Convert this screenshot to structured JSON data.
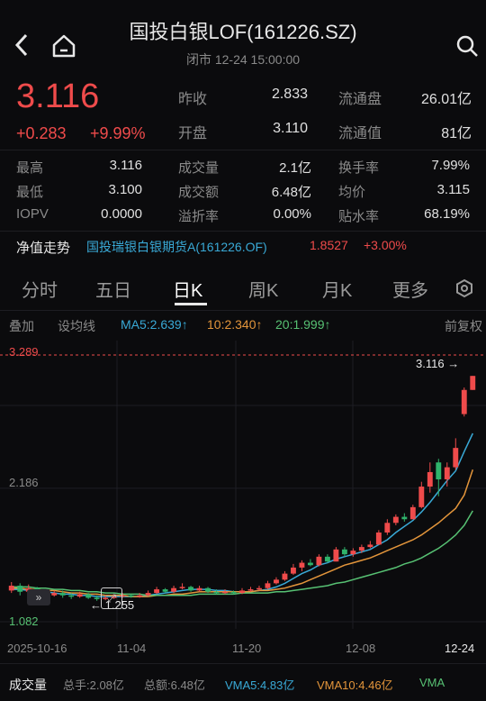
{
  "header": {
    "title": "国投白银LOF(161226.SZ)",
    "status": "闭市 12-24 15:00:00"
  },
  "quote": {
    "price": "3.116",
    "change": "+0.283",
    "change_pct": "+9.99%"
  },
  "stats_top": [
    {
      "label": "昨收",
      "value": "2.833"
    },
    {
      "label": "开盘",
      "value": "3.110"
    },
    {
      "label": "流通盘",
      "value": "26.01亿"
    },
    {
      "label": "流通值",
      "value": "81亿"
    }
  ],
  "stats_grid": {
    "col1": [
      {
        "label": "最高",
        "value": "3.116"
      },
      {
        "label": "最低",
        "value": "3.100"
      },
      {
        "label": "IOPV",
        "value": "0.0000"
      }
    ],
    "col2": [
      {
        "label": "成交量",
        "value": "2.1亿"
      },
      {
        "label": "成交额",
        "value": "6.48亿"
      },
      {
        "label": "溢折率",
        "value": "0.00%"
      }
    ],
    "col3": [
      {
        "label": "换手率",
        "value": "7.99%"
      },
      {
        "label": "均价",
        "value": "3.115"
      },
      {
        "label": "贴水率",
        "value": "68.19%"
      }
    ]
  },
  "nav": {
    "label": "净值走势",
    "fund": "国投瑞银白银期货A(161226.OF)",
    "value": "1.8527",
    "change": "+3.00%"
  },
  "tabs": [
    "分时",
    "五日",
    "日K",
    "周K",
    "月K",
    "更多"
  ],
  "active_tab": "日K",
  "ma_row": {
    "overlay": "叠加",
    "set_ma": "设均线",
    "ma5": "MA5:2.639↑",
    "ma10": "10:2.340↑",
    "ma20": "20:1.999↑",
    "adjust": "前复权"
  },
  "chart_data": {
    "type": "candlestick",
    "y_labels": {
      "top": "3.289",
      "mid": "2.186",
      "bottom": "1.082"
    },
    "last_price_label": "3.116",
    "low_marker": "1.255",
    "x_ticks": [
      "2025-10-16",
      "11-04",
      "11-20",
      "12-08",
      "12-24"
    ],
    "ylim": [
      1.082,
      3.289
    ],
    "candles": [
      {
        "o": 1.34,
        "c": 1.38,
        "h": 1.41,
        "l": 1.32
      },
      {
        "o": 1.38,
        "c": 1.33,
        "h": 1.4,
        "l": 1.3
      },
      {
        "o": 1.33,
        "c": 1.36,
        "h": 1.39,
        "l": 1.31
      },
      {
        "o": 1.36,
        "c": 1.31,
        "h": 1.37,
        "l": 1.28
      },
      {
        "o": 1.31,
        "c": 1.3,
        "h": 1.33,
        "l": 1.27
      },
      {
        "o": 1.3,
        "c": 1.32,
        "h": 1.34,
        "l": 1.29
      },
      {
        "o": 1.32,
        "c": 1.3,
        "h": 1.34,
        "l": 1.28
      },
      {
        "o": 1.3,
        "c": 1.29,
        "h": 1.32,
        "l": 1.27
      },
      {
        "o": 1.29,
        "c": 1.31,
        "h": 1.33,
        "l": 1.28
      },
      {
        "o": 1.31,
        "c": 1.28,
        "h": 1.32,
        "l": 1.27
      },
      {
        "o": 1.28,
        "c": 1.27,
        "h": 1.3,
        "l": 1.255
      },
      {
        "o": 1.27,
        "c": 1.28,
        "h": 1.3,
        "l": 1.26
      },
      {
        "o": 1.28,
        "c": 1.29,
        "h": 1.31,
        "l": 1.27
      },
      {
        "o": 1.29,
        "c": 1.3,
        "h": 1.32,
        "l": 1.28
      },
      {
        "o": 1.3,
        "c": 1.29,
        "h": 1.31,
        "l": 1.28
      },
      {
        "o": 1.29,
        "c": 1.3,
        "h": 1.32,
        "l": 1.28
      },
      {
        "o": 1.3,
        "c": 1.32,
        "h": 1.34,
        "l": 1.29
      },
      {
        "o": 1.32,
        "c": 1.35,
        "h": 1.37,
        "l": 1.31
      },
      {
        "o": 1.35,
        "c": 1.33,
        "h": 1.36,
        "l": 1.32
      },
      {
        "o": 1.33,
        "c": 1.36,
        "h": 1.38,
        "l": 1.32
      },
      {
        "o": 1.36,
        "c": 1.37,
        "h": 1.4,
        "l": 1.35
      },
      {
        "o": 1.37,
        "c": 1.34,
        "h": 1.38,
        "l": 1.33
      },
      {
        "o": 1.34,
        "c": 1.36,
        "h": 1.38,
        "l": 1.33
      },
      {
        "o": 1.36,
        "c": 1.33,
        "h": 1.37,
        "l": 1.32
      },
      {
        "o": 1.33,
        "c": 1.32,
        "h": 1.35,
        "l": 1.31
      },
      {
        "o": 1.32,
        "c": 1.33,
        "h": 1.35,
        "l": 1.31
      },
      {
        "o": 1.33,
        "c": 1.32,
        "h": 1.34,
        "l": 1.31
      },
      {
        "o": 1.32,
        "c": 1.34,
        "h": 1.36,
        "l": 1.31
      },
      {
        "o": 1.34,
        "c": 1.35,
        "h": 1.37,
        "l": 1.33
      },
      {
        "o": 1.35,
        "c": 1.36,
        "h": 1.38,
        "l": 1.34
      },
      {
        "o": 1.36,
        "c": 1.4,
        "h": 1.42,
        "l": 1.35
      },
      {
        "o": 1.4,
        "c": 1.43,
        "h": 1.45,
        "l": 1.39
      },
      {
        "o": 1.43,
        "c": 1.48,
        "h": 1.5,
        "l": 1.42
      },
      {
        "o": 1.48,
        "c": 1.53,
        "h": 1.56,
        "l": 1.47
      },
      {
        "o": 1.53,
        "c": 1.57,
        "h": 1.59,
        "l": 1.5
      },
      {
        "o": 1.57,
        "c": 1.55,
        "h": 1.6,
        "l": 1.54
      },
      {
        "o": 1.55,
        "c": 1.62,
        "h": 1.64,
        "l": 1.54
      },
      {
        "o": 1.62,
        "c": 1.58,
        "h": 1.64,
        "l": 1.57
      },
      {
        "o": 1.58,
        "c": 1.68,
        "h": 1.7,
        "l": 1.58
      },
      {
        "o": 1.68,
        "c": 1.64,
        "h": 1.7,
        "l": 1.62
      },
      {
        "o": 1.64,
        "c": 1.67,
        "h": 1.69,
        "l": 1.62
      },
      {
        "o": 1.67,
        "c": 1.7,
        "h": 1.72,
        "l": 1.65
      },
      {
        "o": 1.7,
        "c": 1.72,
        "h": 1.75,
        "l": 1.69
      },
      {
        "o": 1.72,
        "c": 1.82,
        "h": 1.84,
        "l": 1.72
      },
      {
        "o": 1.82,
        "c": 1.9,
        "h": 1.93,
        "l": 1.8
      },
      {
        "o": 1.9,
        "c": 1.95,
        "h": 1.97,
        "l": 1.88
      },
      {
        "o": 1.95,
        "c": 1.93,
        "h": 1.98,
        "l": 1.91
      },
      {
        "o": 1.93,
        "c": 2.03,
        "h": 2.05,
        "l": 1.93
      },
      {
        "o": 2.03,
        "c": 2.2,
        "h": 2.24,
        "l": 2.02
      },
      {
        "o": 2.2,
        "c": 2.32,
        "h": 2.4,
        "l": 2.15
      },
      {
        "o": 2.4,
        "c": 2.26,
        "h": 2.43,
        "l": 2.12
      },
      {
        "o": 2.26,
        "c": 2.36,
        "h": 2.4,
        "l": 2.2
      },
      {
        "o": 2.36,
        "c": 2.52,
        "h": 2.6,
        "l": 2.34
      },
      {
        "o": 2.8,
        "c": 3.0,
        "h": 3.02,
        "l": 2.78
      },
      {
        "o": 3.0,
        "c": 3.116,
        "h": 3.116,
        "l": 3.0
      }
    ],
    "ma_lines": [
      {
        "name": "MA5",
        "color": "#39a9d6",
        "values": [
          1.35,
          1.35,
          1.34,
          1.33,
          1.33,
          1.32,
          1.31,
          1.31,
          1.3,
          1.3,
          1.29,
          1.29,
          1.29,
          1.29,
          1.29,
          1.29,
          1.3,
          1.31,
          1.32,
          1.33,
          1.34,
          1.35,
          1.35,
          1.35,
          1.34,
          1.34,
          1.33,
          1.33,
          1.33,
          1.34,
          1.35,
          1.37,
          1.4,
          1.44,
          1.48,
          1.51,
          1.55,
          1.57,
          1.6,
          1.62,
          1.64,
          1.66,
          1.68,
          1.72,
          1.76,
          1.82,
          1.87,
          1.92,
          1.99,
          2.07,
          2.16,
          2.25,
          2.33,
          2.49,
          2.64
        ]
      },
      {
        "name": "MA10",
        "color": "#e3953b",
        "values": [
          1.36,
          1.36,
          1.35,
          1.35,
          1.34,
          1.34,
          1.33,
          1.32,
          1.32,
          1.31,
          1.31,
          1.3,
          1.3,
          1.3,
          1.29,
          1.29,
          1.29,
          1.3,
          1.3,
          1.31,
          1.31,
          1.32,
          1.33,
          1.33,
          1.33,
          1.33,
          1.33,
          1.33,
          1.33,
          1.34,
          1.34,
          1.35,
          1.36,
          1.38,
          1.4,
          1.43,
          1.46,
          1.49,
          1.52,
          1.55,
          1.57,
          1.59,
          1.61,
          1.64,
          1.67,
          1.7,
          1.73,
          1.76,
          1.8,
          1.85,
          1.9,
          1.96,
          2.02,
          2.13,
          2.34
        ]
      },
      {
        "name": "MA20",
        "color": "#57c173",
        "values": [
          1.37,
          1.37,
          1.37,
          1.36,
          1.36,
          1.35,
          1.35,
          1.34,
          1.34,
          1.33,
          1.33,
          1.32,
          1.32,
          1.31,
          1.31,
          1.31,
          1.3,
          1.3,
          1.3,
          1.3,
          1.3,
          1.3,
          1.31,
          1.31,
          1.31,
          1.31,
          1.31,
          1.32,
          1.32,
          1.32,
          1.32,
          1.33,
          1.33,
          1.34,
          1.35,
          1.36,
          1.37,
          1.38,
          1.4,
          1.41,
          1.43,
          1.45,
          1.47,
          1.49,
          1.51,
          1.53,
          1.56,
          1.58,
          1.61,
          1.65,
          1.69,
          1.74,
          1.8,
          1.88,
          2.0
        ]
      }
    ]
  },
  "volume_bar": {
    "label": "成交量",
    "total_hands": "总手:2.08亿",
    "total_amount": "总额:6.48亿",
    "vma5": "VMA5:4.83亿",
    "vma10": "VMA10:4.46亿",
    "vma": "VMA"
  }
}
